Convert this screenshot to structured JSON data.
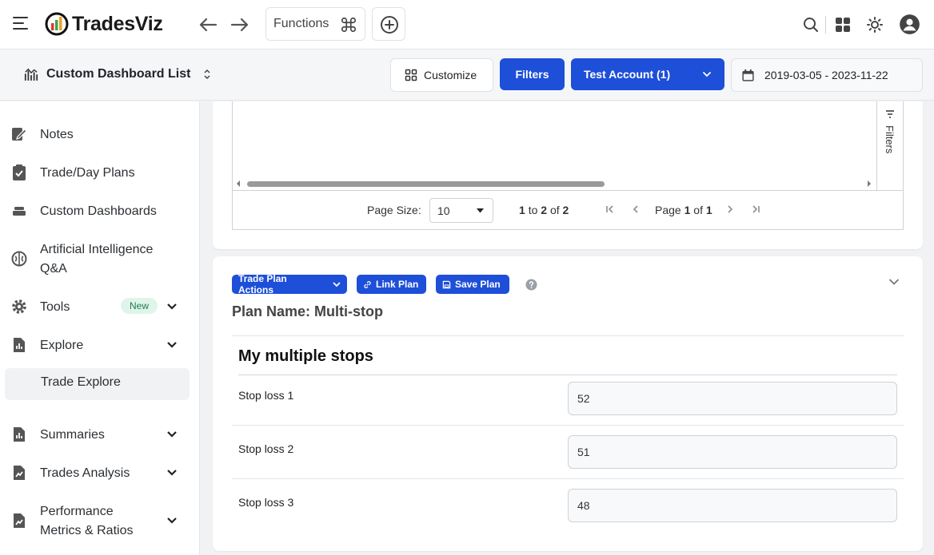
{
  "app": {
    "name": "TradesViz"
  },
  "topbar": {
    "functions_label": "Functions"
  },
  "subbar": {
    "dashboard_list_label": "Custom Dashboard List",
    "customize_label": "Customize",
    "filters_label": "Filters",
    "account_label": "Test Account (1)",
    "date_range": "2019-03-05 - 2023-11-22"
  },
  "sidebar": {
    "items": [
      {
        "label": "Notes"
      },
      {
        "label": "Trade/Day Plans"
      },
      {
        "label": "Custom Dashboards"
      },
      {
        "label_line1": "Artificial Intelligence",
        "label_line2": "Q&A"
      },
      {
        "label": "Tools",
        "badge": "New"
      },
      {
        "label": "Explore"
      },
      {
        "label": "Summaries"
      },
      {
        "label": "Trades Analysis"
      },
      {
        "label_line1": "Performance",
        "label_line2": "Metrics & Ratios"
      }
    ],
    "sub_item": "Trade Explore"
  },
  "grid": {
    "filters_rail_label": "Filters",
    "page_size_label": "Page Size:",
    "page_size_value": "10",
    "range_from": "1",
    "range_to_word": "to",
    "range_to": "2",
    "range_of_word": "of",
    "range_total": "2",
    "page_word": "Page",
    "page_current": "1",
    "page_of_word": "of",
    "page_total": "1"
  },
  "plan": {
    "actions_label": "Trade Plan Actions",
    "link_label": "Link Plan",
    "save_label": "Save Plan",
    "name_label": "Plan Name: Multi-stop",
    "section_title": "My multiple stops",
    "rows": [
      {
        "label": "Stop loss 1",
        "value": "52"
      },
      {
        "label": "Stop loss 2",
        "value": "51"
      },
      {
        "label": "Stop loss 3",
        "value": "48"
      }
    ]
  },
  "colors": {
    "primary": "#1e4fd8",
    "badge_bg": "#dff5ea",
    "badge_text": "#1f7a4d"
  }
}
